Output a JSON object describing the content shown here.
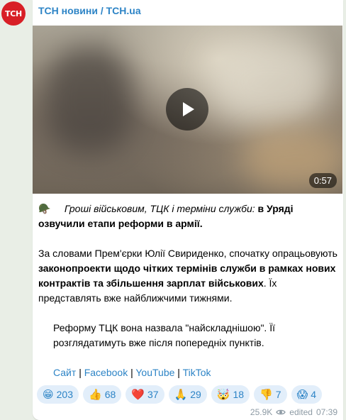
{
  "avatar": {
    "text": "ТСН",
    "color": "#d81f26"
  },
  "channel": {
    "name": "ТСН новини / TCH.ua"
  },
  "video": {
    "duration": "0:57",
    "play_icon": "play-icon"
  },
  "post": {
    "line1_emoji": "🪖",
    "line1_italic": "Гроші військовим, ТЦК і терміни служби:",
    "line1_bold": "в Уряді озвучили етапи реформи в армії.",
    "p2_text1": "За словами Прем'єрки Юлії Свириденко, спочатку опрацьовують ",
    "p2_bold": "законопроекти щодо чітких термінів служби в рамках нових контрактів та збільшення зарплат військових",
    "p2_text2": ". Їх представлять вже найближчими тижнями.",
    "p3_text": "Реформу ТЦК вона назвала \"найскладнішою\". Її розглядатимуть вже після попередніх пунктів.",
    "links": [
      "Сайт",
      "Facebook",
      "YouTube",
      "TikTok"
    ],
    "separator": "|"
  },
  "reactions": [
    {
      "emoji": "😁",
      "count": "203"
    },
    {
      "emoji": "👍",
      "count": "68"
    },
    {
      "emoji": "❤️",
      "count": "37"
    },
    {
      "emoji": "🙏",
      "count": "29"
    },
    {
      "emoji": "🤯",
      "count": "18"
    },
    {
      "emoji": "👎",
      "count": "7"
    },
    {
      "emoji": "😱",
      "count": "4"
    }
  ],
  "meta": {
    "views": "25.9K",
    "edited_label": "edited",
    "time": "07:39",
    "views_icon": "eye-icon"
  }
}
